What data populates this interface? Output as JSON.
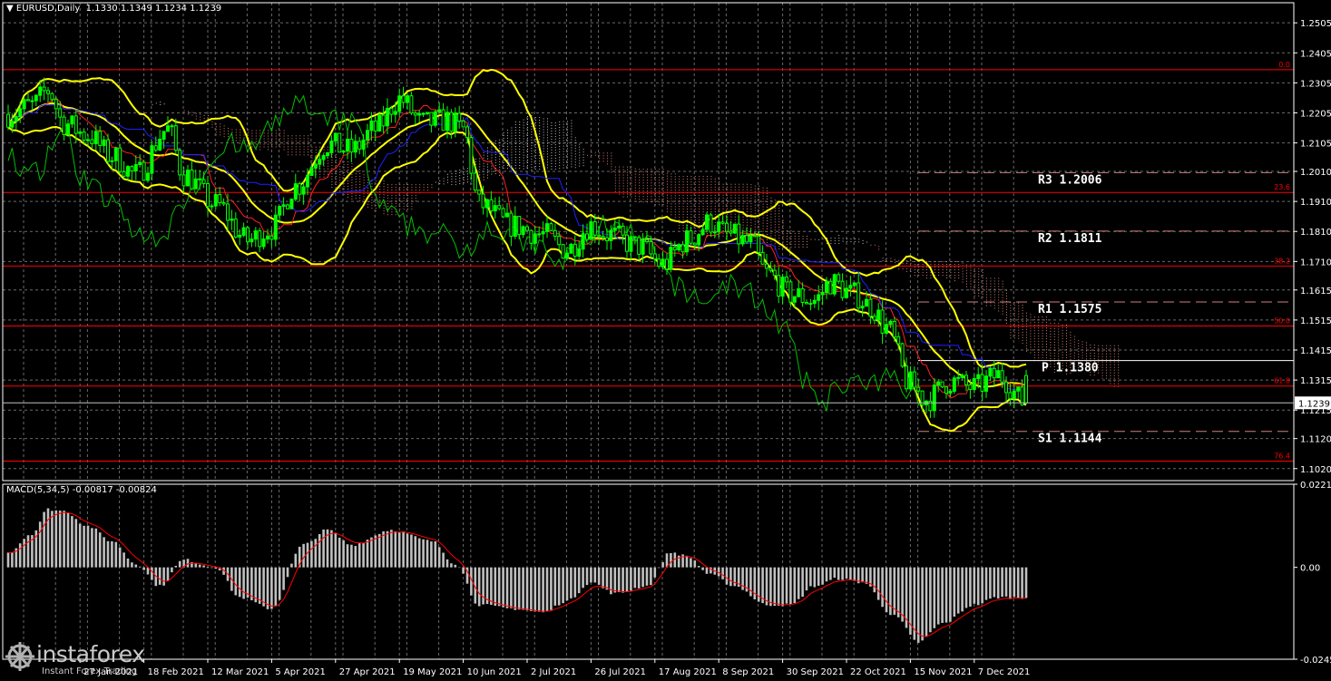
{
  "header": {
    "symbol": "EURUSD,Daily",
    "ohlc": "1.1330 1.1349 1.1234 1.1239",
    "macd_label": "MACD(5,34,5) -0.00817 -0.00824"
  },
  "watermark": {
    "name": "instaforex",
    "sub": "Instant Forex Trading"
  },
  "colors": {
    "background": "#000000",
    "grid": "#6a6a6a",
    "axis": "#ffffff",
    "candle": "#00ff00",
    "bollinger": "#ffff00",
    "fib": "#ff0000",
    "pivot": "#ffffff",
    "tenkan": "#ff2020",
    "kijun": "#2020ff",
    "chikou": "#00c000",
    "cloud": "#c8c8c8",
    "macd_hist": "#c0c0c0",
    "macd_signal": "#ff0000",
    "price_box_bg": "#ffffff",
    "price_box_fg": "#000000"
  },
  "chart_data": {
    "type": "candlestick",
    "price_axis": {
      "ylim": [
        1.098,
        1.2572
      ],
      "ticks": [
        "1.2505",
        "1.2405",
        "1.2305",
        "1.2205",
        "1.2105",
        "1.2010",
        "1.1910",
        "1.1810",
        "1.1710",
        "1.1615",
        "1.1515",
        "1.1415",
        "1.1315",
        "1.1215",
        "1.1120",
        "1.1020"
      ],
      "current_price": "1.1239"
    },
    "x_axis": {
      "labels": [
        {
          "date": "27 Jan 2021",
          "bar": 18
        },
        {
          "date": "18 Feb 2021",
          "bar": 34
        },
        {
          "date": "12 Mar 2021",
          "bar": 50
        },
        {
          "date": "5 Apr 2021",
          "bar": 66
        },
        {
          "date": "27 Apr 2021",
          "bar": 82
        },
        {
          "date": "19 May 2021",
          "bar": 98
        },
        {
          "date": "10 Jun 2021",
          "bar": 114
        },
        {
          "date": "2 Jul 2021",
          "bar": 130
        },
        {
          "date": "26 Jul 2021",
          "bar": 146
        },
        {
          "date": "17 Aug 2021",
          "bar": 162
        },
        {
          "date": "8 Sep 2021",
          "bar": 178
        },
        {
          "date": "30 Sep 2021",
          "bar": 194
        },
        {
          "date": "22 Oct 2021",
          "bar": 210
        },
        {
          "date": "15 Nov 2021",
          "bar": 226
        },
        {
          "date": "7 Dec 2021",
          "bar": 242
        }
      ],
      "total_bars": 256
    },
    "close_anchors": [
      [
        0,
        1.22
      ],
      [
        6,
        1.223
      ],
      [
        10,
        1.228
      ],
      [
        14,
        1.217
      ],
      [
        20,
        1.213
      ],
      [
        26,
        1.206
      ],
      [
        32,
        1.2
      ],
      [
        40,
        1.215
      ],
      [
        44,
        1.2
      ],
      [
        52,
        1.19
      ],
      [
        60,
        1.178
      ],
      [
        66,
        1.182
      ],
      [
        72,
        1.196
      ],
      [
        80,
        1.21
      ],
      [
        86,
        1.208
      ],
      [
        92,
        1.215
      ],
      [
        98,
        1.225
      ],
      [
        104,
        1.217
      ],
      [
        110,
        1.218
      ],
      [
        114,
        1.215
      ],
      [
        118,
        1.19
      ],
      [
        126,
        1.183
      ],
      [
        134,
        1.18
      ],
      [
        140,
        1.175
      ],
      [
        146,
        1.183
      ],
      [
        150,
        1.18
      ],
      [
        158,
        1.176
      ],
      [
        164,
        1.17
      ],
      [
        170,
        1.178
      ],
      [
        176,
        1.184
      ],
      [
        180,
        1.18
      ],
      [
        186,
        1.177
      ],
      [
        190,
        1.167
      ],
      [
        196,
        1.16
      ],
      [
        202,
        1.158
      ],
      [
        206,
        1.164
      ],
      [
        212,
        1.16
      ],
      [
        216,
        1.156
      ],
      [
        220,
        1.149
      ],
      [
        226,
        1.13
      ],
      [
        230,
        1.125
      ],
      [
        236,
        1.131
      ],
      [
        242,
        1.129
      ],
      [
        248,
        1.133
      ],
      [
        255,
        1.1239
      ]
    ],
    "fibonacci": [
      {
        "label": "0.0",
        "price": 1.2349
      },
      {
        "label": "23.6",
        "price": 1.194
      },
      {
        "label": "38.2",
        "price": 1.1695
      },
      {
        "label": "50.0",
        "price": 1.1495
      },
      {
        "label": "61.8",
        "price": 1.1295
      },
      {
        "label": "76.4",
        "price": 1.1045
      }
    ],
    "pivots": [
      {
        "label": "R3",
        "value": "1.2006"
      },
      {
        "label": "R2",
        "value": "1.1811"
      },
      {
        "label": "R1",
        "value": "1.1575"
      },
      {
        "label": "P",
        "value": "1.1380"
      },
      {
        "label": "S1",
        "value": "1.1144"
      }
    ],
    "macd": {
      "ylim": [
        -0.02452,
        0.02218
      ],
      "ticks": [
        "0.02218",
        "0.00",
        "-0.02452"
      ],
      "anchors": [
        [
          0,
          0.004
        ],
        [
          6,
          0.009
        ],
        [
          10,
          0.0155
        ],
        [
          14,
          0.015
        ],
        [
          20,
          0.011
        ],
        [
          26,
          0.007
        ],
        [
          32,
          0.001
        ],
        [
          38,
          -0.005
        ],
        [
          44,
          0.002
        ],
        [
          52,
          0.0
        ],
        [
          58,
          -0.008
        ],
        [
          66,
          -0.011
        ],
        [
          74,
          0.006
        ],
        [
          80,
          0.01
        ],
        [
          86,
          0.006
        ],
        [
          96,
          0.01
        ],
        [
          106,
          0.007
        ],
        [
          112,
          0.001
        ],
        [
          118,
          -0.01
        ],
        [
          126,
          -0.011
        ],
        [
          134,
          -0.012
        ],
        [
          140,
          -0.009
        ],
        [
          146,
          -0.004
        ],
        [
          152,
          -0.007
        ],
        [
          160,
          -0.005
        ],
        [
          166,
          0.004
        ],
        [
          170,
          0.003
        ],
        [
          176,
          -0.002
        ],
        [
          182,
          -0.005
        ],
        [
          190,
          -0.01
        ],
        [
          196,
          -0.01
        ],
        [
          202,
          -0.005
        ],
        [
          208,
          -0.003
        ],
        [
          214,
          -0.004
        ],
        [
          222,
          -0.013
        ],
        [
          228,
          -0.02
        ],
        [
          234,
          -0.015
        ],
        [
          242,
          -0.01
        ],
        [
          248,
          -0.008
        ],
        [
          255,
          -0.00817
        ]
      ],
      "signal_last": -0.00824
    }
  }
}
